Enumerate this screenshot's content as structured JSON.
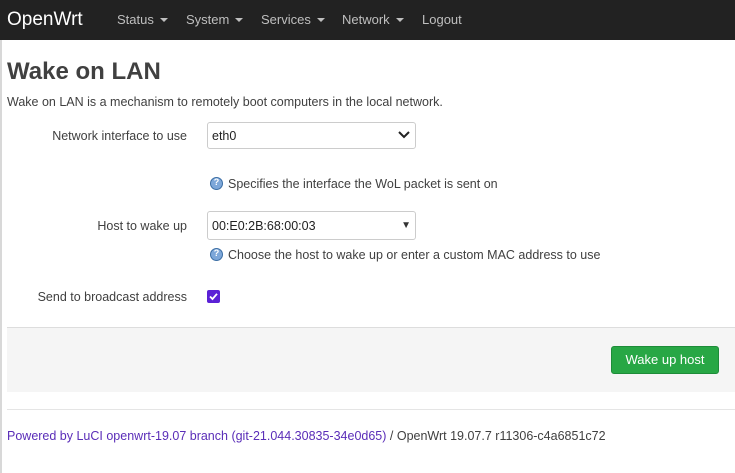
{
  "header": {
    "brand": "OpenWrt",
    "menu": [
      {
        "label": "Status",
        "has_caret": true
      },
      {
        "label": "System",
        "has_caret": true
      },
      {
        "label": "Services",
        "has_caret": true
      },
      {
        "label": "Network",
        "has_caret": true
      },
      {
        "label": "Logout",
        "has_caret": false
      }
    ]
  },
  "page": {
    "title": "Wake on LAN",
    "description": "Wake on LAN is a mechanism to remotely boot computers in the local network."
  },
  "form": {
    "interface": {
      "label": "Network interface to use",
      "value": "eth0",
      "hint": "Specifies the interface the WoL packet is sent on"
    },
    "host": {
      "label": "Host to wake up",
      "value": "00:E0:2B:68:00:03",
      "hint": "Choose the host to wake up or enter a custom MAC address to use"
    },
    "broadcast": {
      "label": "Send to broadcast address",
      "checked": true
    }
  },
  "actions": {
    "wake_label": "Wake up host"
  },
  "footer": {
    "link_text": "Powered by LuCI openwrt-19.07 branch (git-21.044.30835-34e0d65)",
    "version_text": " / OpenWrt 19.07.7 r11306-c4a6851c72"
  },
  "colors": {
    "navbar": "#222222",
    "button": "#28a745",
    "link": "#5a2db8",
    "checkbox": "#5b21d6"
  }
}
